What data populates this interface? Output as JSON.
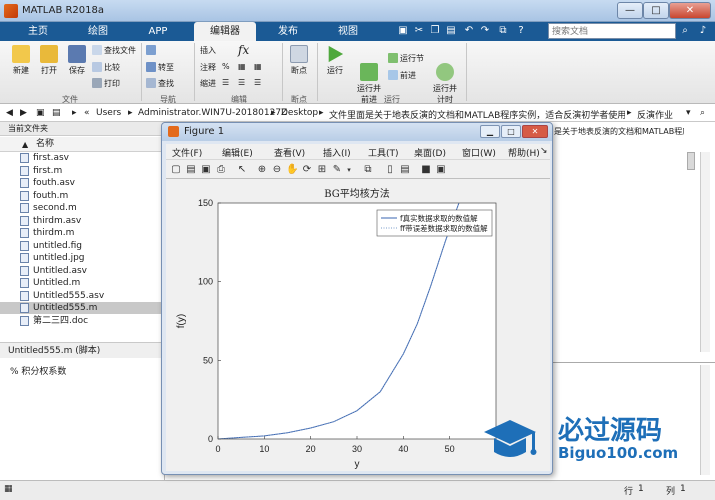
{
  "window": {
    "title": "MATLAB R2018a",
    "min": "—",
    "max": "□",
    "close": "✕"
  },
  "tabs": [
    "主页",
    "绘图",
    "APP",
    "编辑器",
    "发布",
    "视图"
  ],
  "search": {
    "placeholder": "搜索文档"
  },
  "ribbon": {
    "file": {
      "new": "新建",
      "open": "打开",
      "save": "保存",
      "find_files": "查找文件",
      "compare": "比较",
      "print": "打印",
      "group": "文件"
    },
    "nav": {
      "goto": "转至",
      "find": "查找",
      "group": "导航"
    },
    "edit": {
      "insert": "插入",
      "comment": "注释",
      "indent": "缩进",
      "fx": "fx",
      "group": "编辑"
    },
    "breakpoints": {
      "label": "断点",
      "group": "断点"
    },
    "run": {
      "run": "运行",
      "run_advance": "运行并\n前进",
      "run_section": "运行节",
      "advance": "前进",
      "run_time": "运行并\n计时",
      "group": "运行"
    }
  },
  "address": {
    "parts": [
      "Users",
      "Administrator.WIN7U-20180127Z",
      "Desktop",
      "文件里面是关于地表反演的文档和MATLAB程序实例，适合反演初学者使用学习",
      "反演作业"
    ]
  },
  "current_folder": {
    "label": "当前文件夹",
    "column": "名称"
  },
  "files": [
    "first.asv",
    "first.m",
    "fouth.asv",
    "fouth.m",
    "second.m",
    "thirdm.asv",
    "thirdm.m",
    "untitled.fig",
    "untitled.jpg",
    "Untitled.asv",
    "Untitled.m",
    "Untitled555.asv",
    "Untitled555.m",
    "第二三四.doc"
  ],
  "selected_file": "Untitled555.m",
  "details": {
    "header": "Untitled555.m  (脚本)",
    "text": "% 积分权系数"
  },
  "right_pane_text": "是关于地表反演的文档和MATLAB程序实例，适合反演初...",
  "status": {
    "row_label": "行",
    "row": "1",
    "col_label": "列",
    "col": "1"
  },
  "watermark": {
    "title": "必过源码",
    "url": "Biguo100.com"
  },
  "figure": {
    "title": "Figure 1",
    "menu": [
      "文件(F)",
      "编辑(E)",
      "查看(V)",
      "插入(I)",
      "工具(T)",
      "桌面(D)",
      "窗口(W)",
      "帮助(H)"
    ]
  },
  "chart_data": {
    "type": "line",
    "title": "BG平均核方法",
    "xlabel": "y",
    "ylabel": "f(y)",
    "xlim": [
      0,
      60
    ],
    "ylim": [
      0,
      150
    ],
    "xticks": [
      0,
      10,
      20,
      30,
      40,
      50
    ],
    "yticks": [
      0,
      50,
      100,
      150
    ],
    "legend_position": "top-right",
    "series": [
      {
        "name": "f真实数据求取的数值解",
        "style": "solid",
        "color": "#3a64b0",
        "x": [
          0,
          5,
          10,
          15,
          20,
          25,
          30,
          35,
          40,
          43,
          46,
          49,
          52
        ],
        "y": [
          0,
          1,
          2,
          4,
          7,
          11,
          18,
          30,
          54,
          73,
          98,
          125,
          150
        ]
      },
      {
        "name": "ff带误差数据求取的数值解",
        "style": "dotted",
        "color": "#7a9cc9",
        "x": [
          0,
          5,
          10,
          15,
          20,
          25,
          30,
          35,
          40,
          43,
          46,
          49,
          52
        ],
        "y": [
          0,
          1,
          2,
          4,
          7,
          11,
          18,
          30,
          54,
          73,
          98,
          125,
          150
        ]
      }
    ]
  }
}
